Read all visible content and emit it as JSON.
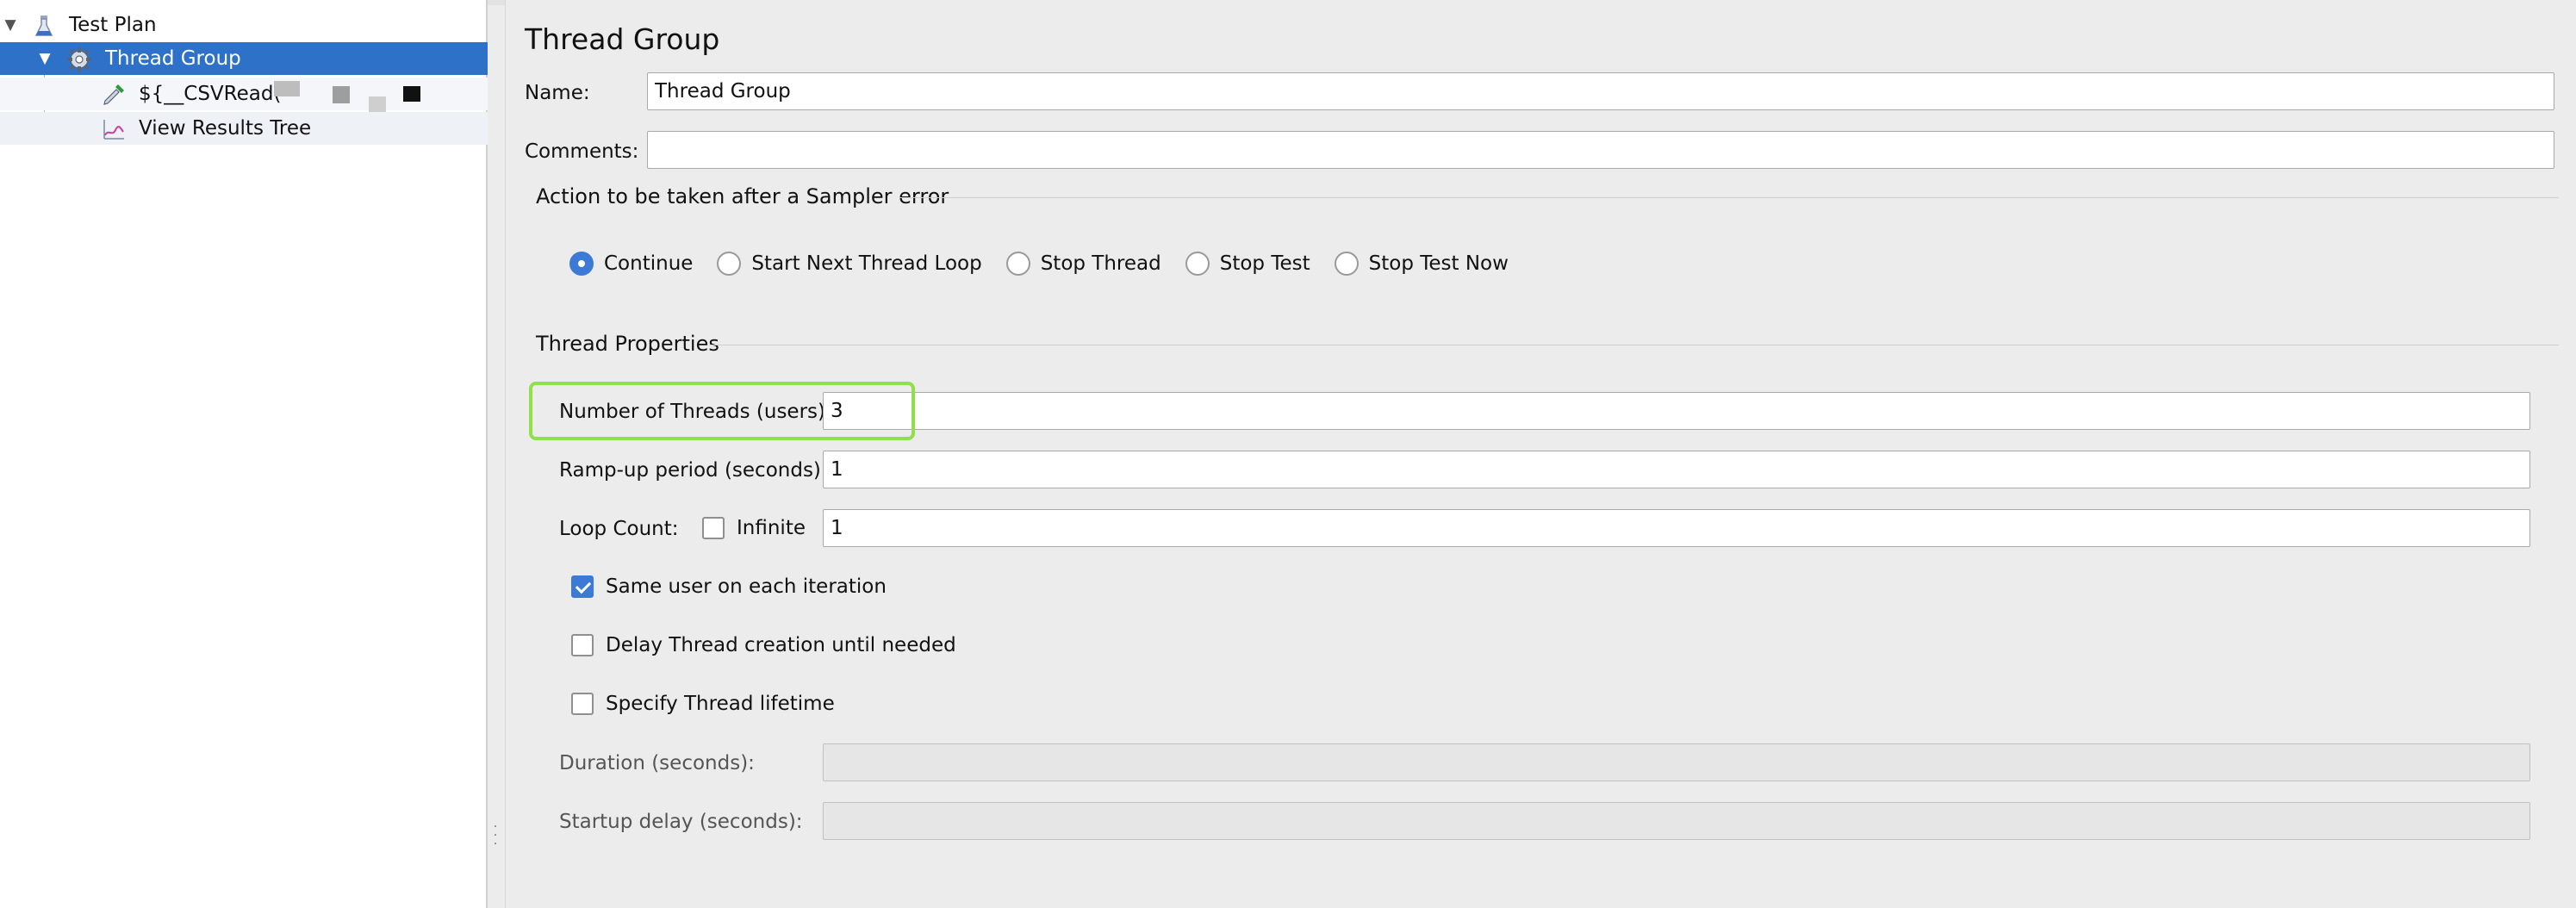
{
  "tree": {
    "items": [
      {
        "label": "Test Plan",
        "icon": "flask-icon"
      },
      {
        "label": "Thread Group",
        "icon": "gear-icon"
      },
      {
        "label": "${__CSVRead(",
        "icon": "pipette-icon"
      },
      {
        "label": "View Results Tree",
        "icon": "graph-icon"
      }
    ],
    "selected_color": "#2e71c9"
  },
  "panel": {
    "title": "Thread Group",
    "name_label": "Name:",
    "name_value": "Thread Group",
    "comments_label": "Comments:",
    "comments_value": "",
    "sampler_error": {
      "title": "Action to be taken after a Sampler error",
      "options": [
        "Continue",
        "Start Next Thread Loop",
        "Stop Thread",
        "Stop Test",
        "Stop Test Now"
      ],
      "selected": "Continue"
    },
    "thread_properties": {
      "title": "Thread Properties",
      "threads_label": "Number of Threads (users):",
      "threads_value": "3",
      "rampup_label": "Ramp-up period (seconds):",
      "rampup_value": "1",
      "loop_label": "Loop Count:",
      "infinite_label": "Infinite",
      "infinite_checked": false,
      "loop_value": "1",
      "same_user_label": "Same user on each iteration",
      "same_user_checked": true,
      "delay_label": "Delay Thread creation until needed",
      "delay_checked": false,
      "lifetime_label": "Specify Thread lifetime",
      "lifetime_checked": false,
      "duration_label": "Duration (seconds):",
      "duration_value": "",
      "startup_label": "Startup delay (seconds):",
      "startup_value": ""
    },
    "accent_color": "#3c7ad6",
    "highlight_color": "#8fe04a"
  }
}
